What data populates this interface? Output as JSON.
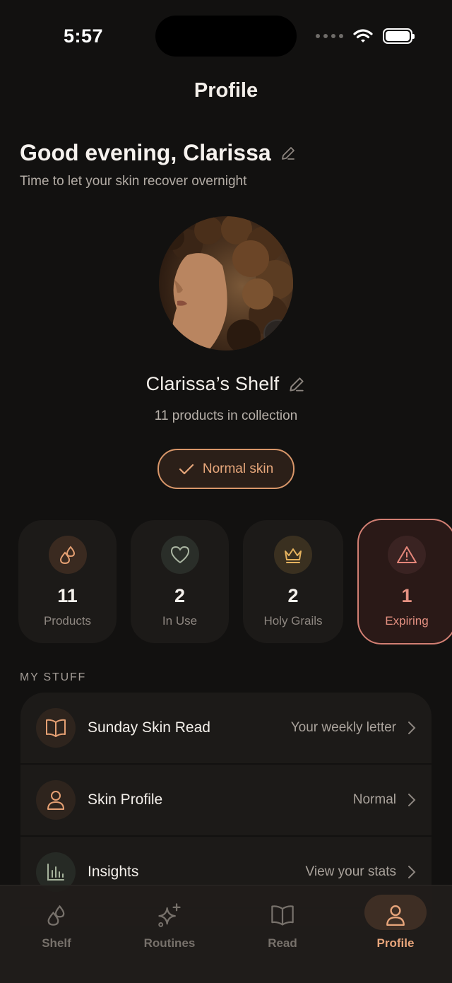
{
  "status_bar": {
    "time": "5:57"
  },
  "header": {
    "title": "Profile"
  },
  "greeting": {
    "title": "Good evening, Clarissa",
    "subtitle": "Time to let your skin recover overnight"
  },
  "shelf": {
    "name": "Clarissa’s Shelf",
    "subtitle": "11 products in collection",
    "skin_type_chip": "Normal skin"
  },
  "stats": [
    {
      "value": "11",
      "label": "Products",
      "icon": "drops-icon"
    },
    {
      "value": "2",
      "label": "In Use",
      "icon": "heart-icon"
    },
    {
      "value": "2",
      "label": "Holy Grails",
      "icon": "crown-icon"
    },
    {
      "value": "1",
      "label": "Expiring",
      "icon": "warning-icon"
    }
  ],
  "my_stuff": {
    "section_label": "MY STUFF",
    "rows": [
      {
        "label": "Sunday Skin Read",
        "value": "Your weekly letter",
        "icon": "book-icon"
      },
      {
        "label": "Skin Profile",
        "value": "Normal",
        "icon": "person-icon"
      },
      {
        "label": "Insights",
        "value": "View your stats",
        "icon": "bar-chart-icon"
      }
    ]
  },
  "tabbar": {
    "tabs": [
      {
        "label": "Shelf",
        "icon": "drops-icon"
      },
      {
        "label": "Routines",
        "icon": "sparkles-icon"
      },
      {
        "label": "Read",
        "icon": "book-icon"
      },
      {
        "label": "Profile",
        "icon": "person-icon",
        "active": true
      }
    ]
  },
  "colors": {
    "background": "#121110",
    "accent": "#e8a57b",
    "warning": "#e59182",
    "card": "#1c1a18"
  }
}
